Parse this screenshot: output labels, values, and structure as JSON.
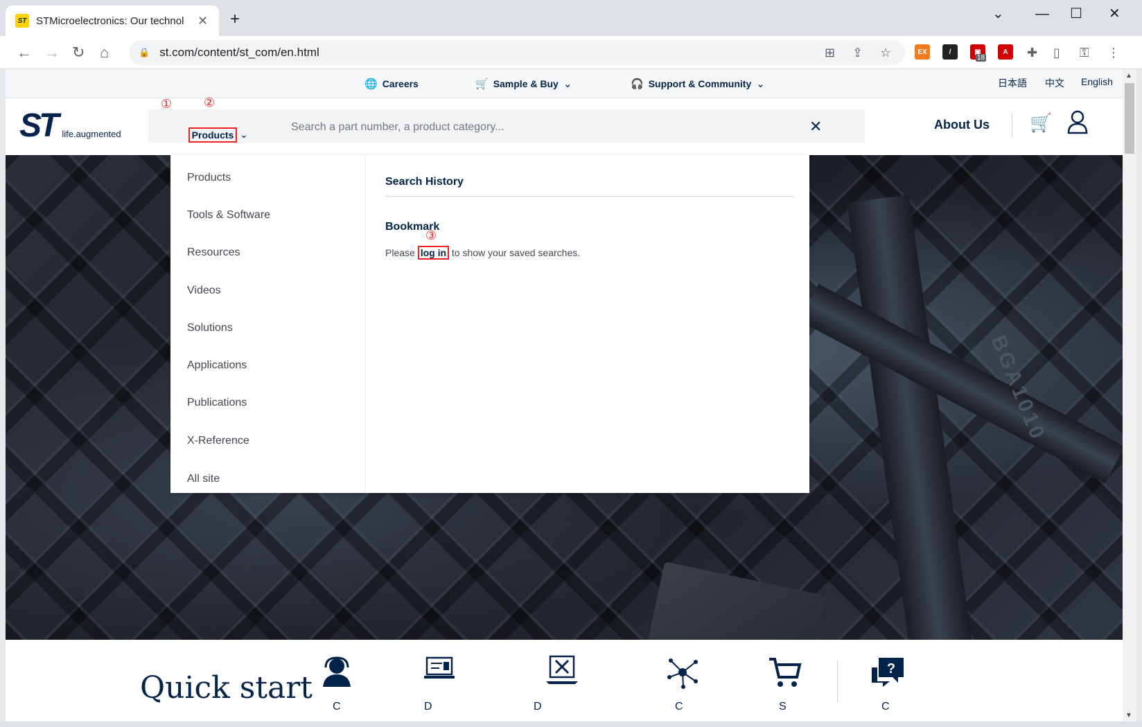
{
  "browser": {
    "tab_title": "STMicroelectronics: Our technol",
    "favicon_text": "ST",
    "url": "st.com/content/st_com/en.html",
    "extension_badge": "18",
    "ext_ex_label": "EX"
  },
  "util_nav": {
    "careers": "Careers",
    "sample_buy": "Sample & Buy",
    "support": "Support & Community",
    "lang_ja": "日本語",
    "lang_zh": "中文",
    "lang_en": "English"
  },
  "header": {
    "logo_text": "ST",
    "tagline": "life.augmented",
    "products_dropdown": "Products",
    "search_placeholder": "Search a part number, a product category...",
    "about_us": "About Us"
  },
  "markers": {
    "one": "①",
    "two": "②",
    "three": "③"
  },
  "search_panel": {
    "categories": [
      "Products",
      "Tools & Software",
      "Resources",
      "Videos",
      "Solutions",
      "Applications",
      "Publications",
      "X-Reference",
      "All site"
    ],
    "search_history": "Search History",
    "bookmark": "Bookmark",
    "please": "Please ",
    "log_in": "log in",
    "saved_text": " to show your saved searches."
  },
  "hero": {
    "engraving": "BGA1010"
  },
  "quick_start": {
    "title": "Quick start",
    "items": [
      "C",
      "D",
      "D",
      "C",
      "S",
      "C"
    ]
  }
}
